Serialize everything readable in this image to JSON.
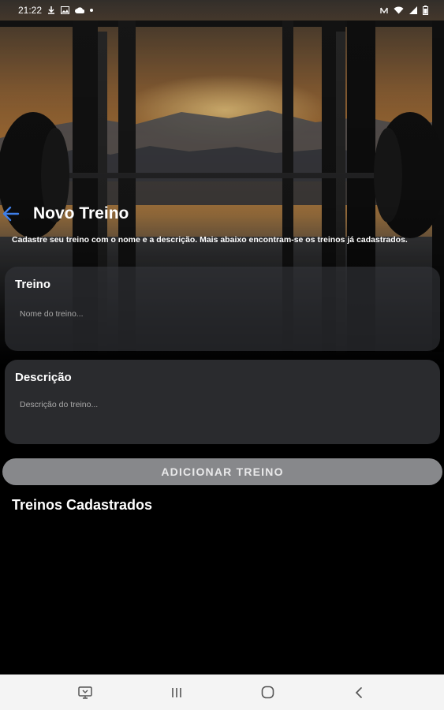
{
  "status_bar": {
    "time": "21:22",
    "left_icons": [
      "download-icon",
      "image-icon",
      "cloud-icon",
      "dot-icon"
    ],
    "right_icons": [
      "nfc-icon",
      "wifi-icon",
      "signal-icon",
      "battery-icon"
    ]
  },
  "header": {
    "back_icon": "arrow-left-icon",
    "title": "Novo Treino"
  },
  "intro_text": "Cadastre seu treino com o nome e a descrição. Mais abaixo encontram-se os treinos já cadastrados.",
  "form": {
    "treino": {
      "label": "Treino",
      "placeholder": "Nome do treino...",
      "value": ""
    },
    "descricao": {
      "label": "Descrição",
      "placeholder": "Descrição do treino...",
      "value": ""
    },
    "add_button_label": "ADICIONAR TREINO"
  },
  "list_section": {
    "title": "Treinos Cadastrados",
    "items": []
  },
  "nav_bar": {
    "buttons": [
      "screen-icon",
      "recent-apps-icon",
      "home-icon",
      "back-icon"
    ]
  },
  "colors": {
    "accent": "#3f7fe8",
    "button_bg": "#87888b",
    "card_bg": "#2a2b2e",
    "nav_bg": "#f4f4f4"
  }
}
